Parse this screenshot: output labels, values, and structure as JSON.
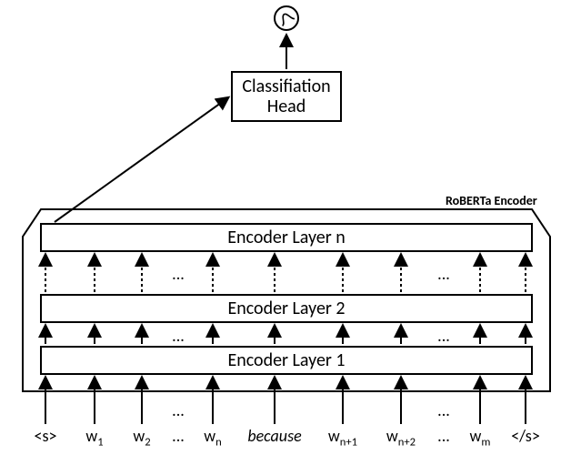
{
  "output_icon": "sigmoid-icon",
  "head": {
    "label_line1": "Classifiation",
    "label_line2": "Head"
  },
  "encoder": {
    "title": "RoBERTa Encoder",
    "layers": {
      "top": "Encoder Layer n",
      "mid": "Encoder Layer 2",
      "bot": "Encoder Layer 1"
    }
  },
  "tokens": {
    "t0": "<s>",
    "t1_base": "w",
    "t1_sub": "1",
    "t2_base": "w",
    "t2_sub": "2",
    "t3_base": "w",
    "t3_sub": "n",
    "t4": "because",
    "t5_base": "w",
    "t5_sub": "n+1",
    "t6_base": "w",
    "t6_sub": "n+2",
    "t7_base": "w",
    "t7_sub": "m",
    "t8": "</s>",
    "dots": "..."
  }
}
